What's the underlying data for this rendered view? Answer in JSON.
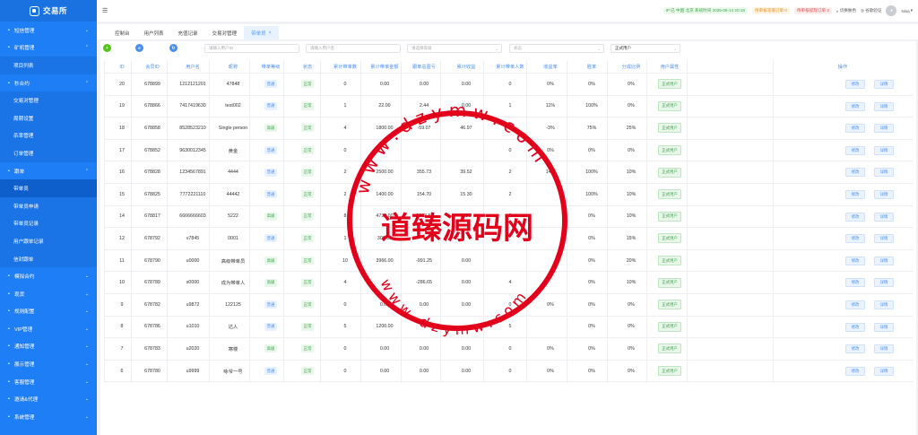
{
  "app": {
    "title": "交易所"
  },
  "sidebar": {
    "items": [
      {
        "key": "account",
        "label": "短信管理",
        "level": 0,
        "arrow": "⌄"
      },
      {
        "key": "miner",
        "label": "矿机管理",
        "level": 0,
        "arrow": "⌃"
      },
      {
        "key": "project-list",
        "label": "项目列表",
        "level": 1
      },
      {
        "key": "contract",
        "label": "秒合约",
        "level": 0,
        "arrow": "⌃"
      },
      {
        "key": "trade-pairs",
        "label": "交易对管理",
        "level": 1
      },
      {
        "key": "period",
        "label": "周期设置",
        "level": 1
      },
      {
        "key": "rate",
        "label": "杀率管理",
        "level": 1
      },
      {
        "key": "orders",
        "label": "订单管理",
        "level": 1
      },
      {
        "key": "follow",
        "label": "跟单",
        "level": 0,
        "arrow": "⌃"
      },
      {
        "key": "leader",
        "label": "带单员",
        "level": 1,
        "active": true
      },
      {
        "key": "leader-apply",
        "label": "带单员申请",
        "level": 1
      },
      {
        "key": "leader-record",
        "label": "带单员记录",
        "level": 1
      },
      {
        "key": "user-follow",
        "label": "用户跟单记录",
        "level": 1
      },
      {
        "key": "follow-order",
        "label": "信封跟单",
        "level": 1
      },
      {
        "key": "sim-contract",
        "label": "模拟合约",
        "level": 0,
        "arrow": "⌄"
      },
      {
        "key": "funds",
        "label": "现货",
        "level": 0,
        "arrow": "⌄"
      },
      {
        "key": "config",
        "label": "规则配置",
        "level": 0,
        "arrow": "⌄"
      },
      {
        "key": "vip",
        "label": "VIP管理",
        "level": 0,
        "arrow": "⌄"
      },
      {
        "key": "notice",
        "label": "通知管理",
        "level": 0,
        "arrow": "⌄"
      },
      {
        "key": "display",
        "label": "展示管理",
        "level": 0,
        "arrow": "⌄"
      },
      {
        "key": "system",
        "label": "客服管理",
        "level": 0,
        "arrow": "⌄"
      },
      {
        "key": "agent",
        "label": "邀请&代理",
        "level": 0,
        "arrow": "⌄"
      },
      {
        "key": "settings",
        "label": "系统管理",
        "level": 0,
        "arrow": "⌄"
      }
    ]
  },
  "header": {
    "status": "IP:已 中国 北京 系统时间 2025-06-14 20:18",
    "pending_withdraw": "待审核充值订单 0",
    "pending_kyc": "待审核提现订单 2",
    "theme": "切换肤色",
    "security": "谷歌验证",
    "username": "Nisa"
  },
  "tabs": [
    {
      "label": "控制台"
    },
    {
      "label": "用户列表"
    },
    {
      "label": "充值记录"
    },
    {
      "label": "交易对管理"
    },
    {
      "label": "带单员",
      "active": true
    }
  ],
  "filters": {
    "user_id": "请输入用户ID",
    "username": "请输入用户名",
    "level": "请选择等级",
    "status": "状态",
    "user_type": "正式用户"
  },
  "table": {
    "columns": [
      "ID",
      "会员ID",
      "用户名",
      "昵称",
      "带单等级",
      "状态",
      "累计带单数",
      "累计带单金额",
      "跟单总盈亏",
      "累计收益",
      "累计带单人数",
      "收益率",
      "胜率",
      "分成比例",
      "用户属性"
    ],
    "op_header": "操作",
    "edit_label": "修改",
    "detail_label": "详情",
    "rows": [
      [
        "20",
        "678899",
        "1212121201",
        "47848",
        "普通",
        "正常",
        "0",
        "0.00",
        "0.00",
        "0.00",
        "0",
        "0%",
        "0%",
        "0%",
        "正式用户"
      ],
      [
        "19",
        "678866",
        "7417419630",
        "test002",
        "普通",
        "正常",
        "1",
        "22.00",
        "2.44",
        "0.00",
        "1",
        "11%",
        "100%",
        "0%",
        "正式用户"
      ],
      [
        "18",
        "678858",
        "8528523210",
        "Single person",
        "高级",
        "正常",
        "4",
        "1800.00",
        "-59.07",
        "46.97",
        "",
        "-3%",
        "75%",
        "25%",
        "正式用户"
      ],
      [
        "17",
        "678852",
        "9630012345",
        "黄金",
        "普通",
        "正常",
        "0",
        "",
        "",
        "",
        "0",
        "0%",
        "0%",
        "0%",
        "正式用户"
      ],
      [
        "16",
        "678828",
        "1234567891",
        "4444",
        "普通",
        "正常",
        "2",
        "2500.00",
        "355.73",
        "39.52",
        "2",
        "14%",
        "100%",
        "10%",
        "正式用户"
      ],
      [
        "15",
        "678825",
        "7772221110",
        "44442",
        "普通",
        "正常",
        "2",
        "1400.00",
        "154.70",
        "15.30",
        "2",
        "",
        "100%",
        "10%",
        "正式用户"
      ],
      [
        "14",
        "678817",
        "6666666603",
        "5222",
        "高级",
        "正常",
        "8",
        "4730.00",
        "-3683.50",
        "8.50",
        "8",
        "",
        "0%",
        "10%",
        "正式用户"
      ],
      [
        "12",
        "678792",
        "v7845",
        "0001",
        "普通",
        "正常",
        "1",
        "300.00",
        "",
        "",
        "",
        "",
        "0%",
        "15%",
        "正式用户"
      ],
      [
        "11",
        "678790",
        "u0000",
        "高级带单员",
        "高级",
        "正常",
        "10",
        "3966.00",
        "-991.25",
        "0.00",
        "",
        "",
        "0%",
        "20%",
        "正式用户"
      ],
      [
        "10",
        "678789",
        "s0000",
        "成为带单人",
        "高级",
        "正常",
        "4",
        "",
        "-286.65",
        "0.00",
        "4",
        "",
        "0%",
        "10%",
        "正式用户"
      ],
      [
        "9",
        "678782",
        "u9872",
        "122125",
        "普通",
        "正常",
        "0",
        "0.00",
        "0.00",
        "0.00",
        "0",
        "0%",
        "0%",
        "0%",
        "正式用户"
      ],
      [
        "8",
        "678786",
        "u1010",
        "达人",
        "普通",
        "正常",
        "5",
        "1200.00",
        "",
        "",
        "5",
        "",
        "0%",
        "0%",
        "正式用户"
      ],
      [
        "7",
        "678783",
        "u2020",
        "寒楼",
        "高级",
        "正常",
        "0",
        "0.00",
        "0.00",
        "0.00",
        "0",
        "0%",
        "0%",
        "0%",
        "正式用户"
      ],
      [
        "6",
        "678780",
        "u9999",
        "咏爷一号",
        "普通",
        "正常",
        "0",
        "0.00",
        "0.00",
        "0.00",
        "0",
        "0%",
        "0%",
        "0%",
        "正式用户"
      ]
    ]
  },
  "watermark": {
    "main": "道臻源码网",
    "arc_top": "w w w . d z y m w . c o m",
    "arc_bottom": "w w w . d z y m w . c o m"
  },
  "colors": {
    "sidebar": "#1e7ef5",
    "accent": "#4a8ef0",
    "stamp": "#e3001b"
  }
}
